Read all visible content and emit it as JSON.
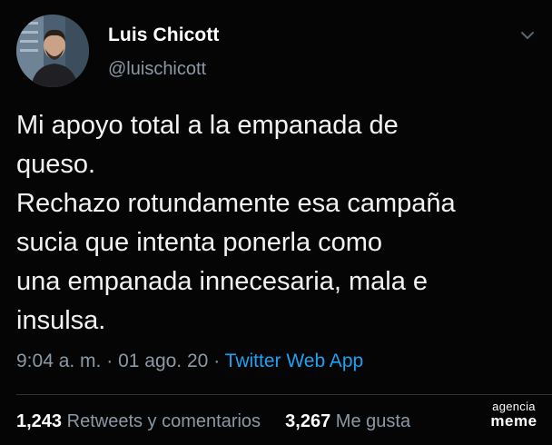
{
  "tweet": {
    "display_name": "Luis Chicott",
    "handle": "@luischicott",
    "lines": [
      "Mi apoyo total a la empanada de",
      "queso.",
      "Rechazo rotundamente esa campaña",
      "sucia que intenta ponerla como",
      "una empanada innecesaria, mala e",
      "insulsa."
    ],
    "time": "9:04 a. m.",
    "date": "01 ago. 20",
    "separator": "·",
    "source": "Twitter Web App",
    "retweets_count": "1,243",
    "retweets_label": "Retweets y comentarios",
    "likes_count": "3,267",
    "likes_label": "Me gusta",
    "menu_icon": "chevron-down-icon",
    "avatar_icon": "avatar"
  },
  "watermark": {
    "line1": "agencia",
    "line2": "meme"
  },
  "colors": {
    "background": "#050505",
    "text": "#f2f2f2",
    "secondary": "#8b98a5",
    "link": "#1da1f2"
  }
}
